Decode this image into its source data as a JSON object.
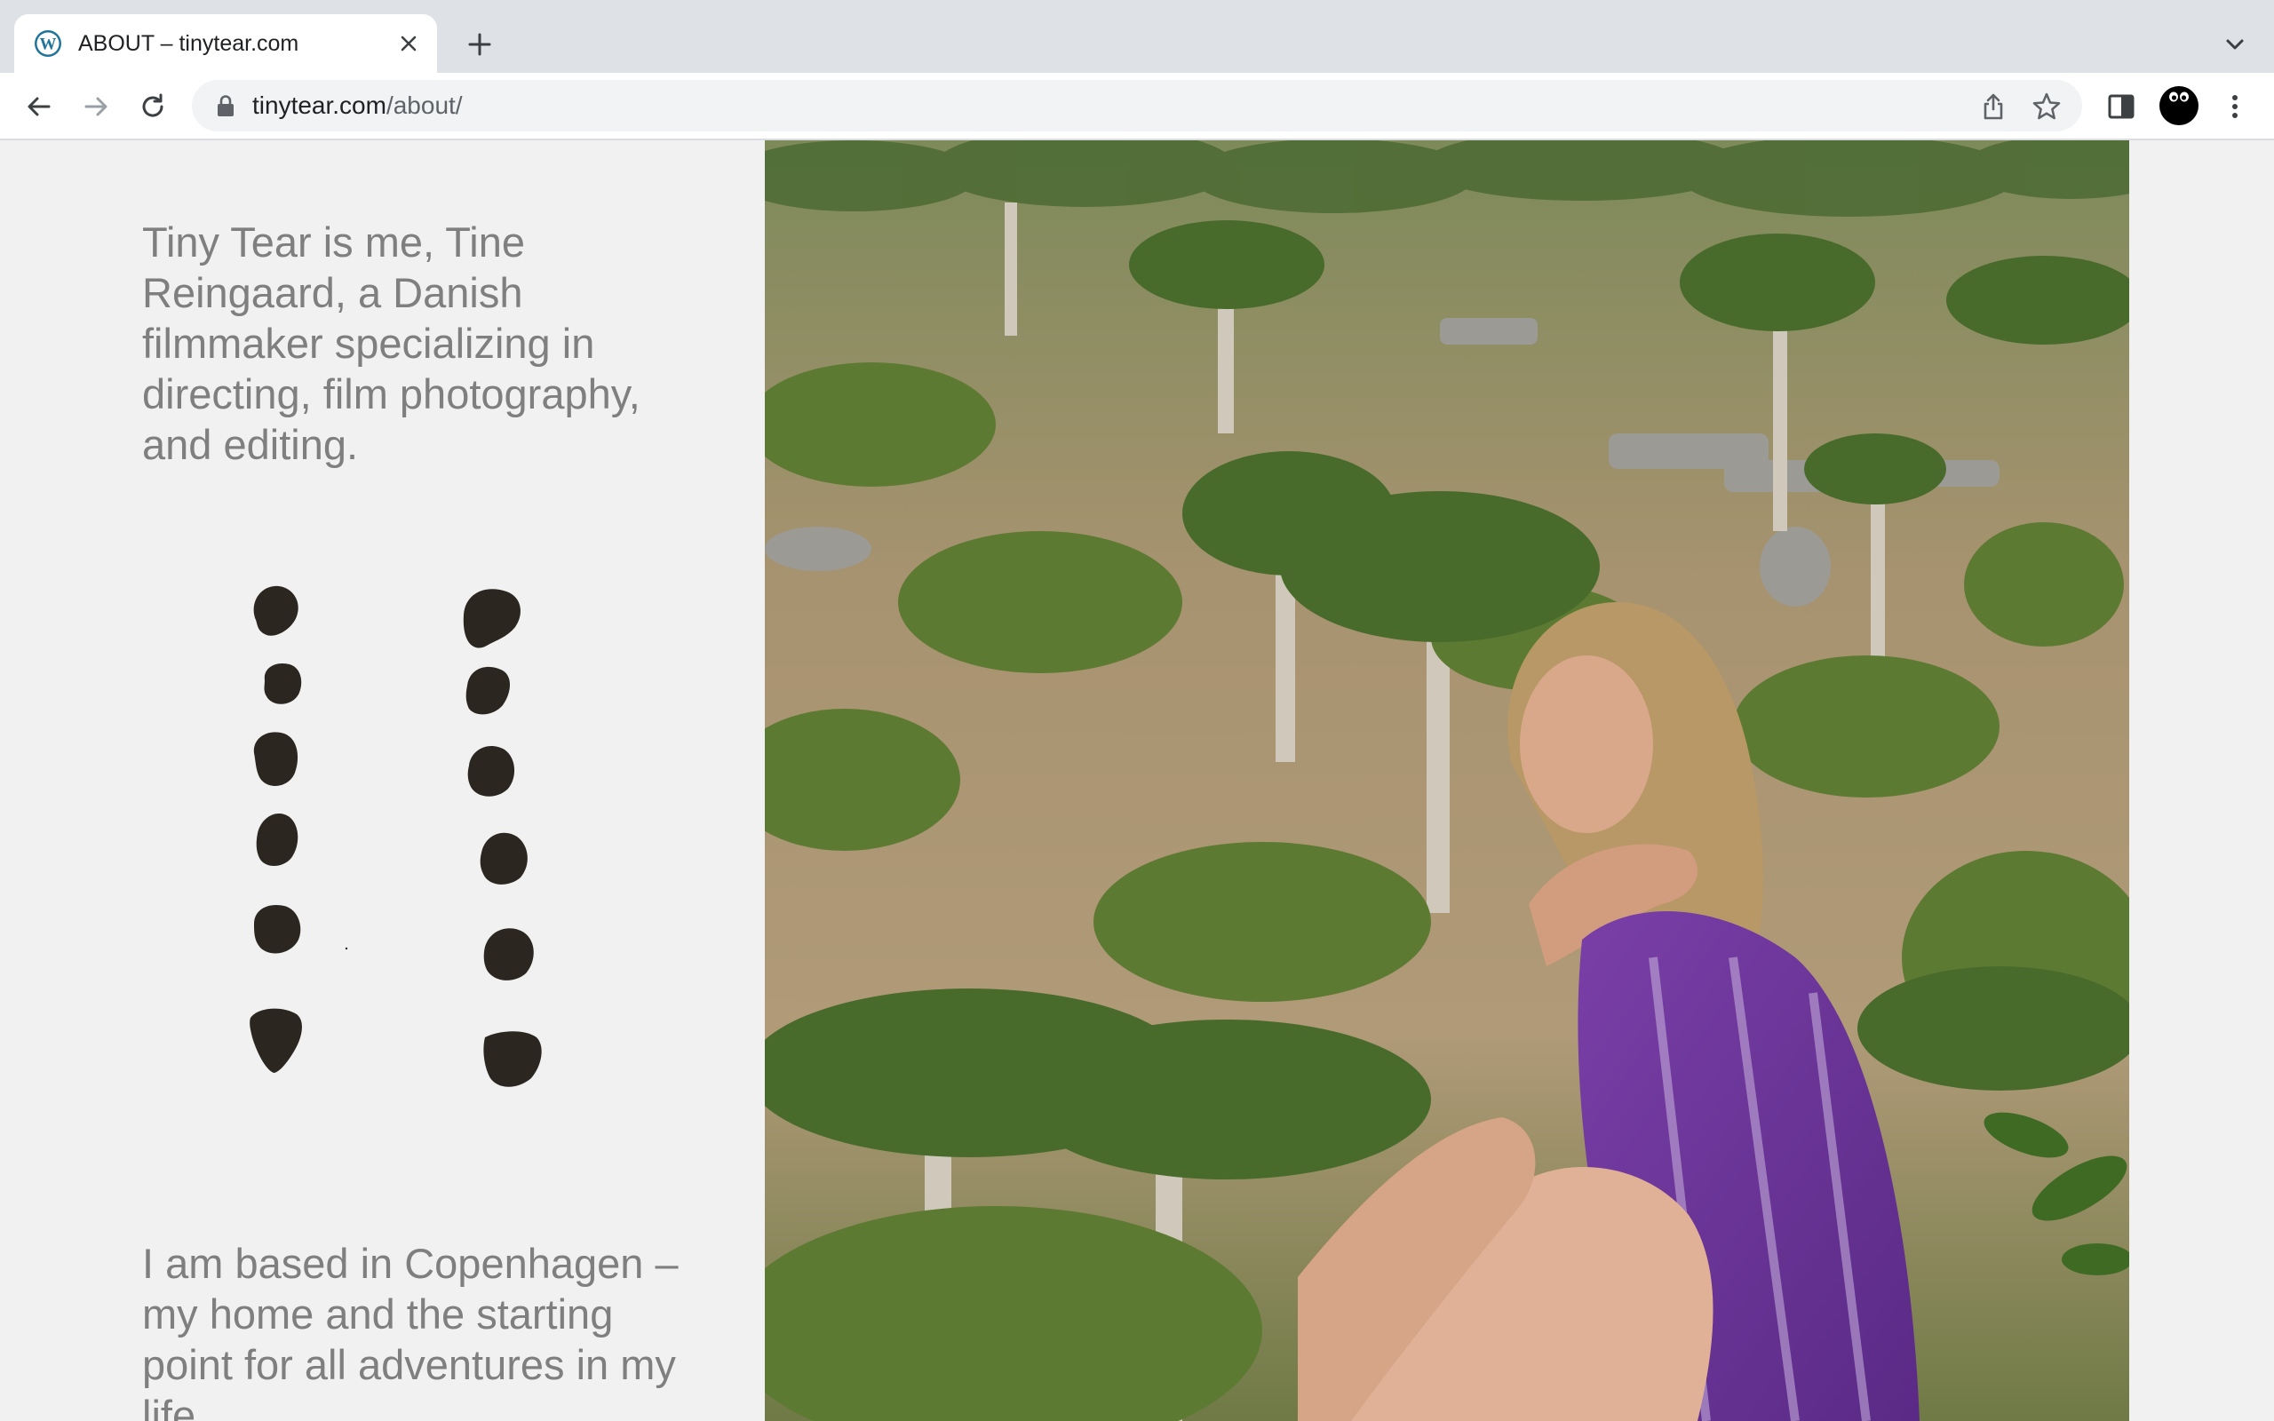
{
  "browser": {
    "tab": {
      "title": "ABOUT – tinytear.com",
      "favicon": "wordpress-icon"
    },
    "toolbar": {
      "url_host": "tinytear.com",
      "url_path": "/about/"
    },
    "icons": {
      "back": "arrow-left-icon",
      "forward": "arrow-right-icon",
      "reload": "reload-icon",
      "lock": "lock-icon",
      "share": "share-icon",
      "bookmark": "star-icon",
      "side_panel": "side-panel-icon",
      "profile": "profile-avatar",
      "menu": "more-vertical-icon",
      "new_tab": "plus-icon",
      "tab_search": "chevron-down-icon",
      "tab_close": "close-icon"
    },
    "colors": {
      "tabstrip": "#dee1e6",
      "toolbar": "#ffffff",
      "omnibox": "#f1f3f4"
    }
  },
  "page": {
    "intro": "Tiny Tear is me, Tine Reingaard, a Danish filmmaker specializing in directing, film photography, and editing.",
    "location": "I am based in Copenhagen – my home and the starting point for all adventures in my life.",
    "text_color": "#7f7f7f",
    "background": "#f1f1f1",
    "ink_color": "#2b2720"
  }
}
